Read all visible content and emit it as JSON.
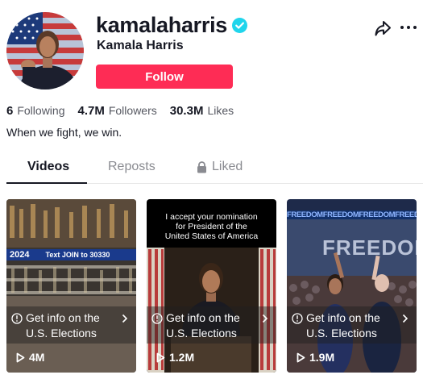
{
  "profile": {
    "username": "kamalaharris",
    "display_name": "Kamala Harris",
    "verified": true,
    "follow_label": "Follow",
    "bio": "When we fight, we win."
  },
  "header_actions": {
    "share_icon": "share-arrow-icon",
    "more_icon": "more-dots-icon"
  },
  "stats": [
    {
      "value": "6",
      "label": "Following"
    },
    {
      "value": "4.7M",
      "label": "Followers"
    },
    {
      "value": "30.3M",
      "label": "Likes"
    }
  ],
  "tabs": [
    {
      "label": "Videos",
      "active": true
    },
    {
      "label": "Reposts",
      "active": false
    },
    {
      "label": "Liked",
      "active": false,
      "icon": "lock-icon"
    }
  ],
  "videos": [
    {
      "overlay_text": [
        "2024",
        "Text JOIN to 30330"
      ],
      "info_line1": "Get info on the",
      "info_line2": "U.S. Elections",
      "views": "4M"
    },
    {
      "caption": [
        "I accept your nomination",
        "for President of the",
        "United States of America"
      ],
      "info_line1": "Get info on the",
      "info_line2": "U.S. Elections",
      "views": "1.2M"
    },
    {
      "overlay_text": [
        "FREEDOMFREEDOMFREEDOMFREEDOMFREEDOMFR",
        "FREEDOM"
      ],
      "info_line1": "Get info on the",
      "info_line2": "U.S. Elections",
      "views": "1.9M"
    }
  ],
  "colors": {
    "follow_button": "#fe2c55",
    "verified_badge": "#20d5ec",
    "text_primary": "#161823",
    "text_secondary": "#555760",
    "tab_inactive": "#8a8b91"
  }
}
